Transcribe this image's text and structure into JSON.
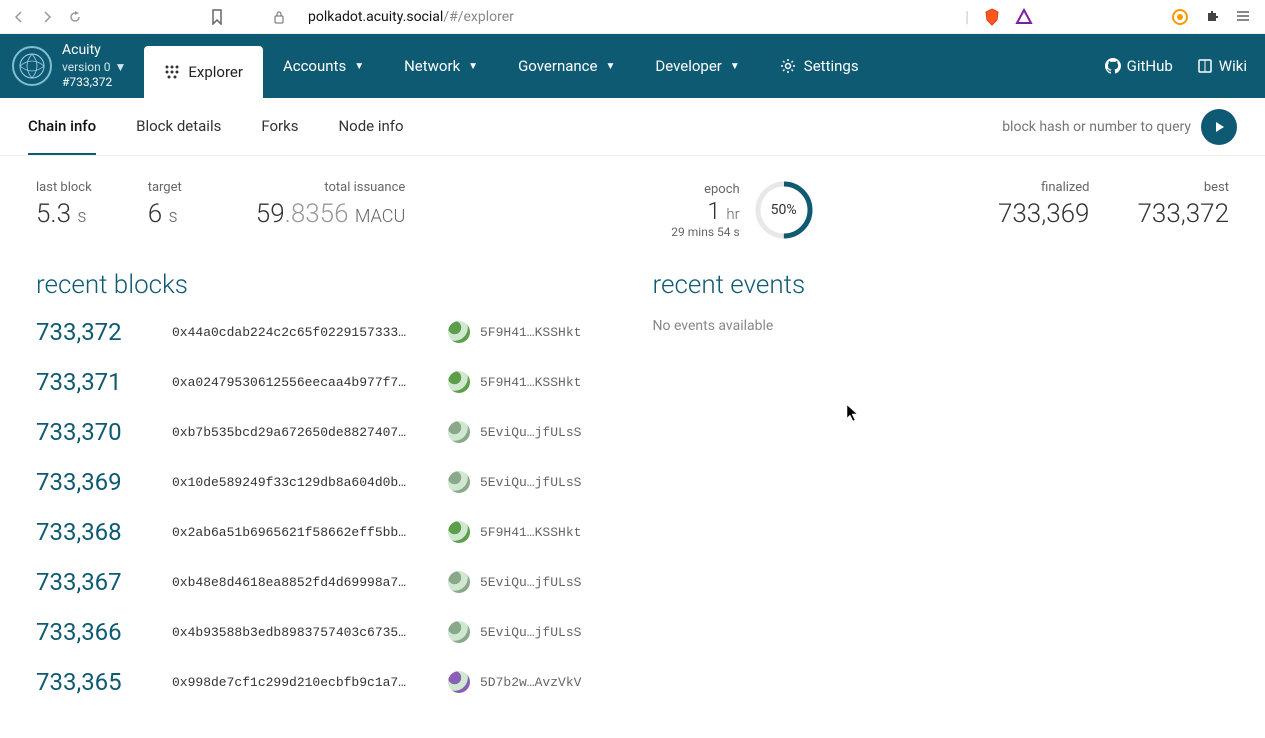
{
  "browser": {
    "url_host": "polkadot.acuity.social",
    "url_path": "/#/explorer"
  },
  "brand": {
    "name": "Acuity",
    "version": "version 0",
    "block": "#733,372"
  },
  "nav": {
    "explorer": "Explorer",
    "accounts": "Accounts",
    "network": "Network",
    "governance": "Governance",
    "developer": "Developer",
    "settings": "Settings",
    "github": "GitHub",
    "wiki": "Wiki"
  },
  "subtabs": {
    "chain_info": "Chain info",
    "block_details": "Block details",
    "forks": "Forks",
    "node_info": "Node info",
    "search_placeholder": "block hash or number to query"
  },
  "stats": {
    "last_block_label": "last block",
    "last_block_value": "5.3",
    "last_block_unit": "s",
    "target_label": "target",
    "target_value": "6",
    "target_unit": "s",
    "issuance_label": "total issuance",
    "issuance_int": "59",
    "issuance_frac": ".8356",
    "issuance_unit": "MACU",
    "epoch_label": "epoch",
    "epoch_big_value": "1",
    "epoch_big_unit": "hr",
    "epoch_small": "29 mins 54 s",
    "epoch_pct": "50%",
    "finalized_label": "finalized",
    "finalized_value": "733,369",
    "best_label": "best",
    "best_value": "733,372"
  },
  "sections": {
    "recent_blocks": "recent blocks",
    "recent_events": "recent events",
    "no_events": "No events available"
  },
  "blocks": [
    {
      "num": "733,372",
      "hash": "0x44a0cdab224c2c65f0229157333…",
      "author": "5F9H41…KSSHkt",
      "color": "#5b9f4a"
    },
    {
      "num": "733,371",
      "hash": "0xa02479530612556eecaa4b977f7…",
      "author": "5F9H41…KSSHkt",
      "color": "#5b9f4a"
    },
    {
      "num": "733,370",
      "hash": "0xb7b535bcd29a672650de8827407…",
      "author": "5EviQu…jfULsS",
      "color": "#8aa88a"
    },
    {
      "num": "733,369",
      "hash": "0x10de589249f33c129db8a604d0b…",
      "author": "5EviQu…jfULsS",
      "color": "#8aa88a"
    },
    {
      "num": "733,368",
      "hash": "0x2ab6a51b6965621f58662eff5bb…",
      "author": "5F9H41…KSSHkt",
      "color": "#5b9f4a"
    },
    {
      "num": "733,367",
      "hash": "0xb48e8d4618ea8852fd4d69998a7…",
      "author": "5EviQu…jfULsS",
      "color": "#8aa88a"
    },
    {
      "num": "733,366",
      "hash": "0x4b93588b3edb8983757403c6735…",
      "author": "5EviQu…jfULsS",
      "color": "#8aa88a"
    },
    {
      "num": "733,365",
      "hash": "0x998de7cf1c299d210ecbfb9c1a7…",
      "author": "5D7b2w…AvzVkV",
      "color": "#8a5fb8"
    }
  ]
}
